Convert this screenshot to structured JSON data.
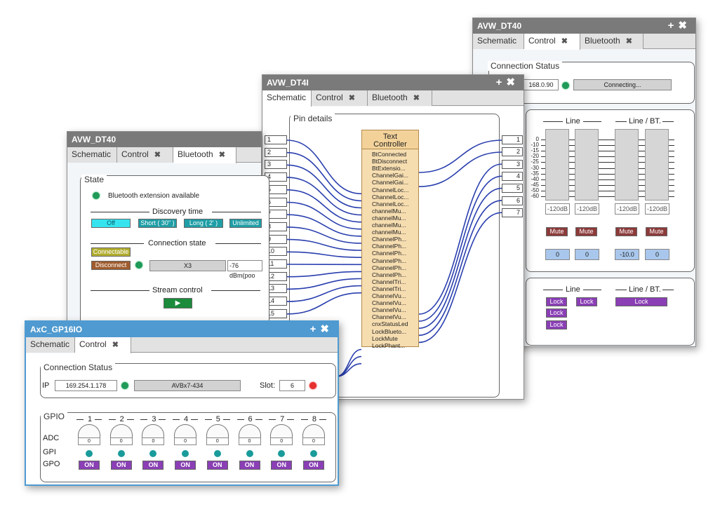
{
  "win_dt40_right": {
    "title": "AVW_DT40",
    "tabs": [
      {
        "label": "Schematic"
      },
      {
        "label": "Control"
      },
      {
        "label": "Bluetooth"
      }
    ],
    "conn_status_label": "Connection Status",
    "ip_value": "168.0.90",
    "status_text": "Connecting...",
    "line_label": "Line",
    "line_bt_label": "Line / BT.",
    "scale": [
      "0",
      "-10",
      "-15",
      "-20",
      "-25",
      "-30",
      "-35",
      "-40",
      "-45",
      "-50",
      "-60"
    ],
    "meter_values": [
      "-120dB",
      "-120dB",
      "-120dB",
      "-120dB"
    ],
    "mute_label": "Mute",
    "gain_values": [
      "0",
      "0",
      "-10.0",
      "0"
    ],
    "lock_label": "Lock",
    "colors": {
      "mute": "#8c3a3a",
      "lock": "#8a3fb5",
      "gain": "#a9c7ec"
    }
  },
  "win_dt4i": {
    "title": "AVW_DT4I",
    "tabs": [
      {
        "label": "Schematic"
      },
      {
        "label": "Control"
      },
      {
        "label": "Bluetooth"
      }
    ],
    "pin_details_label": "Pin details",
    "controller_title_1": "Text",
    "controller_title_2": "Controller",
    "controller_pins": [
      "BtConnected",
      "BtDisconnect",
      "BtExtensio...",
      "ChannelGai...",
      "ChannelGai...",
      "ChannelLoc...",
      "ChannelLoc...",
      "ChannelLoc...",
      "channelMu...",
      "channelMu...",
      "channelMu...",
      "channelMu...",
      "ChannelPh...",
      "ChannelPh...",
      "ChannelPh...",
      "ChannelPh...",
      "ChannelPh...",
      "ChannelPh...",
      "ChannelTri...",
      "ChannelTri...",
      "ChannelVu...",
      "ChannelVu...",
      "ChannelVu...",
      "ChannelVu...",
      "cnxStatusLed",
      "LockBlueto...",
      "LockMute",
      "LockPhant..."
    ],
    "left_inputs": [
      "1",
      "2",
      "3",
      "4",
      "5",
      "6",
      "7",
      "8",
      "9",
      "10",
      "11",
      "12",
      "13",
      "14",
      "15"
    ],
    "right_outputs": [
      "1",
      "2",
      "3",
      "4",
      "5",
      "6",
      "7"
    ]
  },
  "win_dt40_left": {
    "title": "AVW_DT40",
    "tabs": [
      {
        "label": "Schematic"
      },
      {
        "label": "Control"
      },
      {
        "label": "Bluetooth"
      }
    ],
    "state_label": "State",
    "bt_available": "Bluetooth extension available",
    "discovery_label": "Discovery time",
    "discovery_buttons": [
      "Off",
      "Short ( 30\" )",
      "Long ( 2' )",
      "Unlimited"
    ],
    "connection_state_label": "Connection state",
    "connectable_label": "Connectable",
    "disconnect_label": "Disconnect",
    "device_name": "X3",
    "rssi": "-76 dBm(poo",
    "stream_label": "Stream control",
    "play_icon": "▶"
  },
  "win_gp16": {
    "title": "AxC_GP16IO",
    "tabs": [
      {
        "label": "Schematic"
      },
      {
        "label": "Control"
      }
    ],
    "conn_status_label": "Connection Status",
    "ip_label": "IP",
    "ip_value": "169.254.1.178",
    "device": "AVBx7-434",
    "slot_label": "Slot:",
    "slot_value": "6",
    "gpio_label": "GPIO",
    "channels": [
      "1",
      "2",
      "3",
      "4",
      "5",
      "6",
      "7",
      "8"
    ],
    "adc_label": "ADC",
    "gpi_label": "GPI",
    "gpo_label": "GPO",
    "adc_values": [
      "0",
      "0",
      "0",
      "0",
      "0",
      "0",
      "0",
      "0"
    ],
    "gpo_button": "ON"
  }
}
